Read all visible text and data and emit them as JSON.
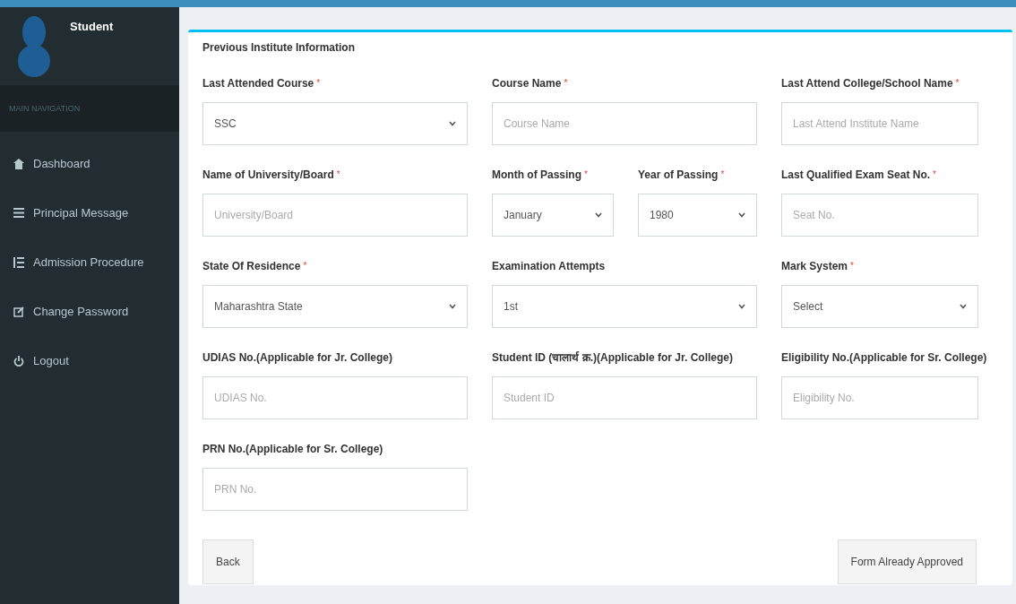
{
  "sidebar": {
    "user": {
      "name": "Student"
    },
    "header": "MAIN NAVIGATION",
    "items": [
      {
        "label": "Dashboard",
        "kind": "dashboard"
      },
      {
        "label": "Principal Message",
        "kind": "list"
      },
      {
        "label": "Admission Procedure",
        "kind": "indent"
      },
      {
        "label": "Change Password",
        "kind": "edit"
      },
      {
        "label": "Logout",
        "kind": "power"
      }
    ]
  },
  "form": {
    "title": "Previous Institute Information",
    "rows": [
      [
        {
          "label": "Last Attended Course",
          "mark": "*",
          "kind": "select",
          "value": "SSC"
        },
        {
          "label": "Course Name",
          "mark": "*",
          "kind": "input",
          "placeholder": "Course Name"
        },
        {
          "label": "Last Attend College/School Name",
          "mark": "*",
          "kind": "input",
          "placeholder": "Last Attend Institute Name"
        }
      ],
      [
        {
          "label": "Name of University/Board",
          "mark": "*",
          "kind": "input",
          "placeholder": "University/Board"
        },
        {
          "label": "Month of Passing",
          "mark": "*",
          "kind": "select",
          "value": "January"
        },
        {
          "label": "Year of Passing",
          "mark": "*",
          "kind": "select",
          "value": "1980"
        },
        {
          "label": "Last Qualified Exam Seat No.",
          "mark": "*",
          "kind": "input",
          "placeholder": "Seat No."
        }
      ],
      [
        {
          "label": "State Of Residence",
          "mark": "*",
          "kind": "select",
          "value": "Maharashtra State"
        },
        {
          "label": "Examination Attempts",
          "kind": "select",
          "value": "1st"
        },
        {
          "label": "Mark System",
          "mark": "*",
          "kind": "select",
          "value": "Select"
        }
      ],
      [
        {
          "label": "UDIAS No.(Applicable for Jr. College)",
          "kind": "input",
          "placeholder": "UDIAS No."
        },
        {
          "label": "Student ID (चालार्थ क्र.)(Applicable for Jr. College)",
          "kind": "input",
          "placeholder": "Student ID"
        },
        {
          "label": "Eligibility No.(Applicable for Sr. College)",
          "kind": "input",
          "placeholder": "Eligibility No."
        }
      ],
      [
        {
          "label": "PRN No.(Applicable for Sr. College)",
          "kind": "input",
          "placeholder": "PRN No."
        }
      ]
    ],
    "buttons": [
      "Back",
      "Form Already Approved"
    ]
  }
}
